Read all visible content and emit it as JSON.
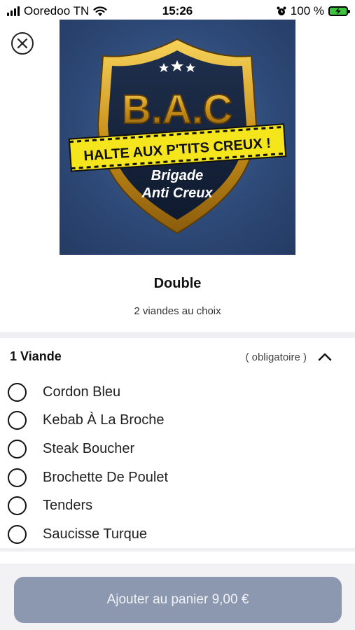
{
  "status_bar": {
    "carrier": "Ooredoo TN",
    "time": "15:26",
    "battery": "100 %"
  },
  "logo": {
    "title": "B.A.C",
    "banner": "HALTE AUX P'TITS CREUX !",
    "line1": "Brigade",
    "line2": "Anti Creux"
  },
  "product": {
    "name": "Double",
    "description": "2 viandes au choix"
  },
  "section": {
    "title": "1 Viande",
    "requirement": "( obligatoire )"
  },
  "options": [
    "Cordon Bleu",
    "Kebab À La Broche",
    "Steak Boucher",
    "Brochette De Poulet",
    "Tenders",
    "Saucisse Turque"
  ],
  "cart_button": {
    "label": "Ajouter au panier 9,00 €"
  },
  "colors": {
    "button": "#8c98b0",
    "logo_background": "#2e4a78",
    "gold": "#d4a017",
    "banner_yellow": "#f5e51c"
  },
  "icons": [
    "signal-icon",
    "wifi-icon",
    "alarm-icon",
    "battery-icon",
    "close-icon",
    "chevron-up-icon"
  ]
}
